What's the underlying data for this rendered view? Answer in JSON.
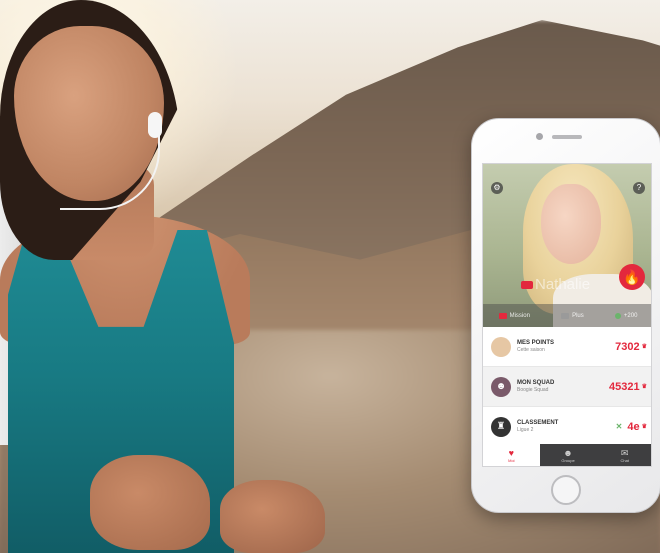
{
  "photo": {
    "subject": "woman-running-with-earphones"
  },
  "app": {
    "profile": {
      "name": "Nathalie",
      "tabs": [
        {
          "label": "Mission",
          "color": "#e3283d"
        },
        {
          "label": "Plus",
          "color": "#9a9a9a"
        },
        {
          "label": "+200",
          "color": "#6bb46b"
        }
      ]
    },
    "rows": [
      {
        "title": "MES POINTS",
        "subtitle": "Cette saison",
        "value": "7302",
        "avatar_color": "#e6c7a4"
      },
      {
        "title": "MON SQUAD",
        "subtitle": "Boogie Squad",
        "value": "45321",
        "avatar_color": "#7a5a6a"
      },
      {
        "title": "CLASSEMENT",
        "subtitle": "Ligue 2",
        "value": "4e",
        "avatar_color": "#333333"
      }
    ],
    "nav": [
      {
        "label": "Moi",
        "icon": "♥"
      },
      {
        "label": "Groupe",
        "icon": "☻"
      },
      {
        "label": "Chat",
        "icon": "✉"
      }
    ],
    "accent_color": "#e3283d"
  }
}
